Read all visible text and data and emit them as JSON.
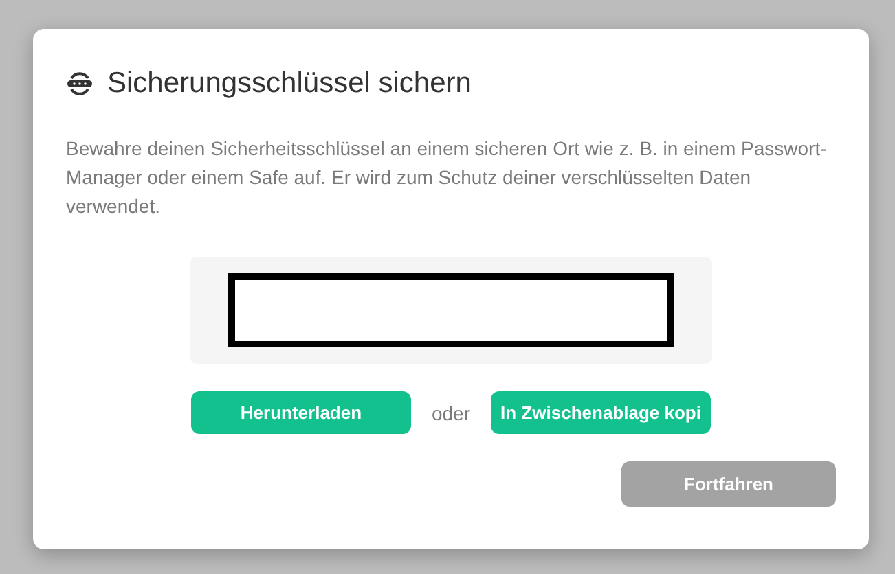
{
  "dialog": {
    "title": "Sicherungsschlüssel sichern",
    "description": "Bewahre deinen Sicherheitsschlüssel an einem sicheren Ort wie z. B. in einem Passwort-Manager oder einem Safe auf. Er wird zum Schutz deiner verschlüsselten Daten verwendet.",
    "separator": "oder",
    "actions": [
      {
        "label": "Herunterladen"
      },
      {
        "label": "In Zwischenablage kopi"
      }
    ],
    "continue_button": {
      "label": "Fortfahren",
      "disabled": true
    }
  }
}
